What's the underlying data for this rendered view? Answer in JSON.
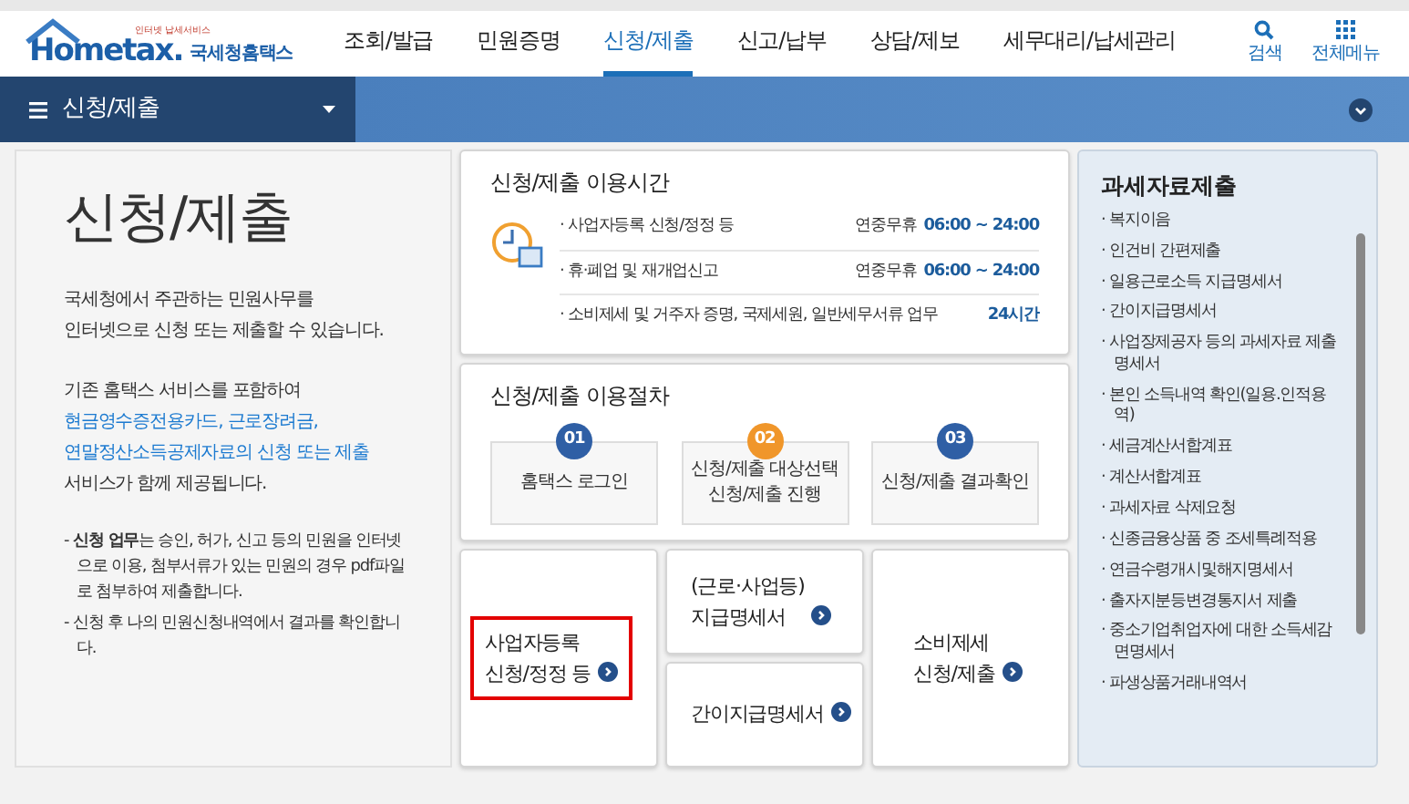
{
  "header": {
    "logo": {
      "tagline": "인터넷 납세서비스",
      "name": "Hometax.",
      "subtitle": "국세청홈택스"
    },
    "nav": [
      {
        "label": "조회/발급",
        "selected": false
      },
      {
        "label": "민원증명",
        "selected": false
      },
      {
        "label": "신청/제출",
        "selected": true
      },
      {
        "label": "신고/납부",
        "selected": false
      },
      {
        "label": "상담/제보",
        "selected": false
      },
      {
        "label": "세무대리/납세관리",
        "selected": false
      }
    ],
    "search": {
      "label": "검색"
    },
    "all_menu": {
      "label": "전체메뉴"
    }
  },
  "section_bar": {
    "title": "신청/제출"
  },
  "intro": {
    "title": "신청/제출",
    "paragraphs": [
      [
        {
          "text": "국세청에서 주관하는 민원사무를",
          "highlight": false
        },
        {
          "text": "인터넷으로 신청 또는 제출할 수 있습니다.",
          "highlight": false
        }
      ],
      [
        {
          "text": "기존 홈택스 서비스를 포함하여",
          "highlight": false
        },
        {
          "text": "현금영수증전용카드, 근로장려금,",
          "highlight": true
        },
        {
          "text": "연말정산소득공제자료의 신청 또는 제출",
          "highlight": true
        },
        {
          "text": "서비스가 함께 제공됩니다.",
          "highlight": false
        }
      ]
    ],
    "notes": [
      "- **신청 업무**는 승인, 허가, 신고 등의 민원을 인터넷으로 이용, 첨부서류가 있는 민원의 경우 pdf파일로 첨부하여 제출합니다.",
      "- 신청 후 나의 민원신청내역에서 결과를 확인합니다."
    ]
  },
  "hours": {
    "title": "신청/제출 이용시간",
    "rows": [
      {
        "label": "· 사업자등록 신청/정정 등",
        "note": "연중무휴",
        "time": "06:00 ~ 24:00"
      },
      {
        "label": "· 휴·폐업 및 재개업신고",
        "note": "연중무휴",
        "time": "06:00 ~ 24:00"
      },
      {
        "label": "· 소비제세 및 거주자 증명, 국제세원, 일반세무서류 업무",
        "time": "24시간"
      }
    ]
  },
  "procedure": {
    "title": "신청/제출 이용절차",
    "steps": [
      {
        "number": "01",
        "label": "홈택스 로그인",
        "color": "#2f5fa5"
      },
      {
        "number": "02",
        "label": "신청/제출 대상선택\n신청/제출 진행",
        "color": "#f0962a"
      },
      {
        "number": "03",
        "label": "신청/제출 결과확인",
        "color": "#2f5fa5"
      }
    ]
  },
  "tiles": [
    {
      "label": "사업자등록\n신청/정정 등",
      "highlighted": true
    },
    {
      "label": "(근로·사업등)\n지급명세서",
      "highlighted": false
    },
    {
      "label": "간이지급명세서",
      "highlighted": false
    },
    {
      "label": "소비제세\n신청/제출",
      "highlighted": false
    }
  ],
  "tax_data": {
    "title": "과세자료제출",
    "items": [
      "· 복지이음",
      "· 인건비 간편제출",
      "· 일용근로소득 지급명세서",
      "· 간이지급명세서",
      "· 사업장제공자 등의 과세자료 제출명세서",
      "· 본인 소득내역 확인(일용.인적용역)",
      "· 세금계산서합계표",
      "· 계산서합계표",
      "· 과세자료 삭제요청",
      "· 신종금융상품 중 조세특례적용",
      "· 연금수령개시및해지명세서",
      "· 출자지분등변경통지서 제출",
      "· 중소기업취업자에 대한 소득세감면명세서",
      "· 파생상품거래내역서"
    ]
  }
}
